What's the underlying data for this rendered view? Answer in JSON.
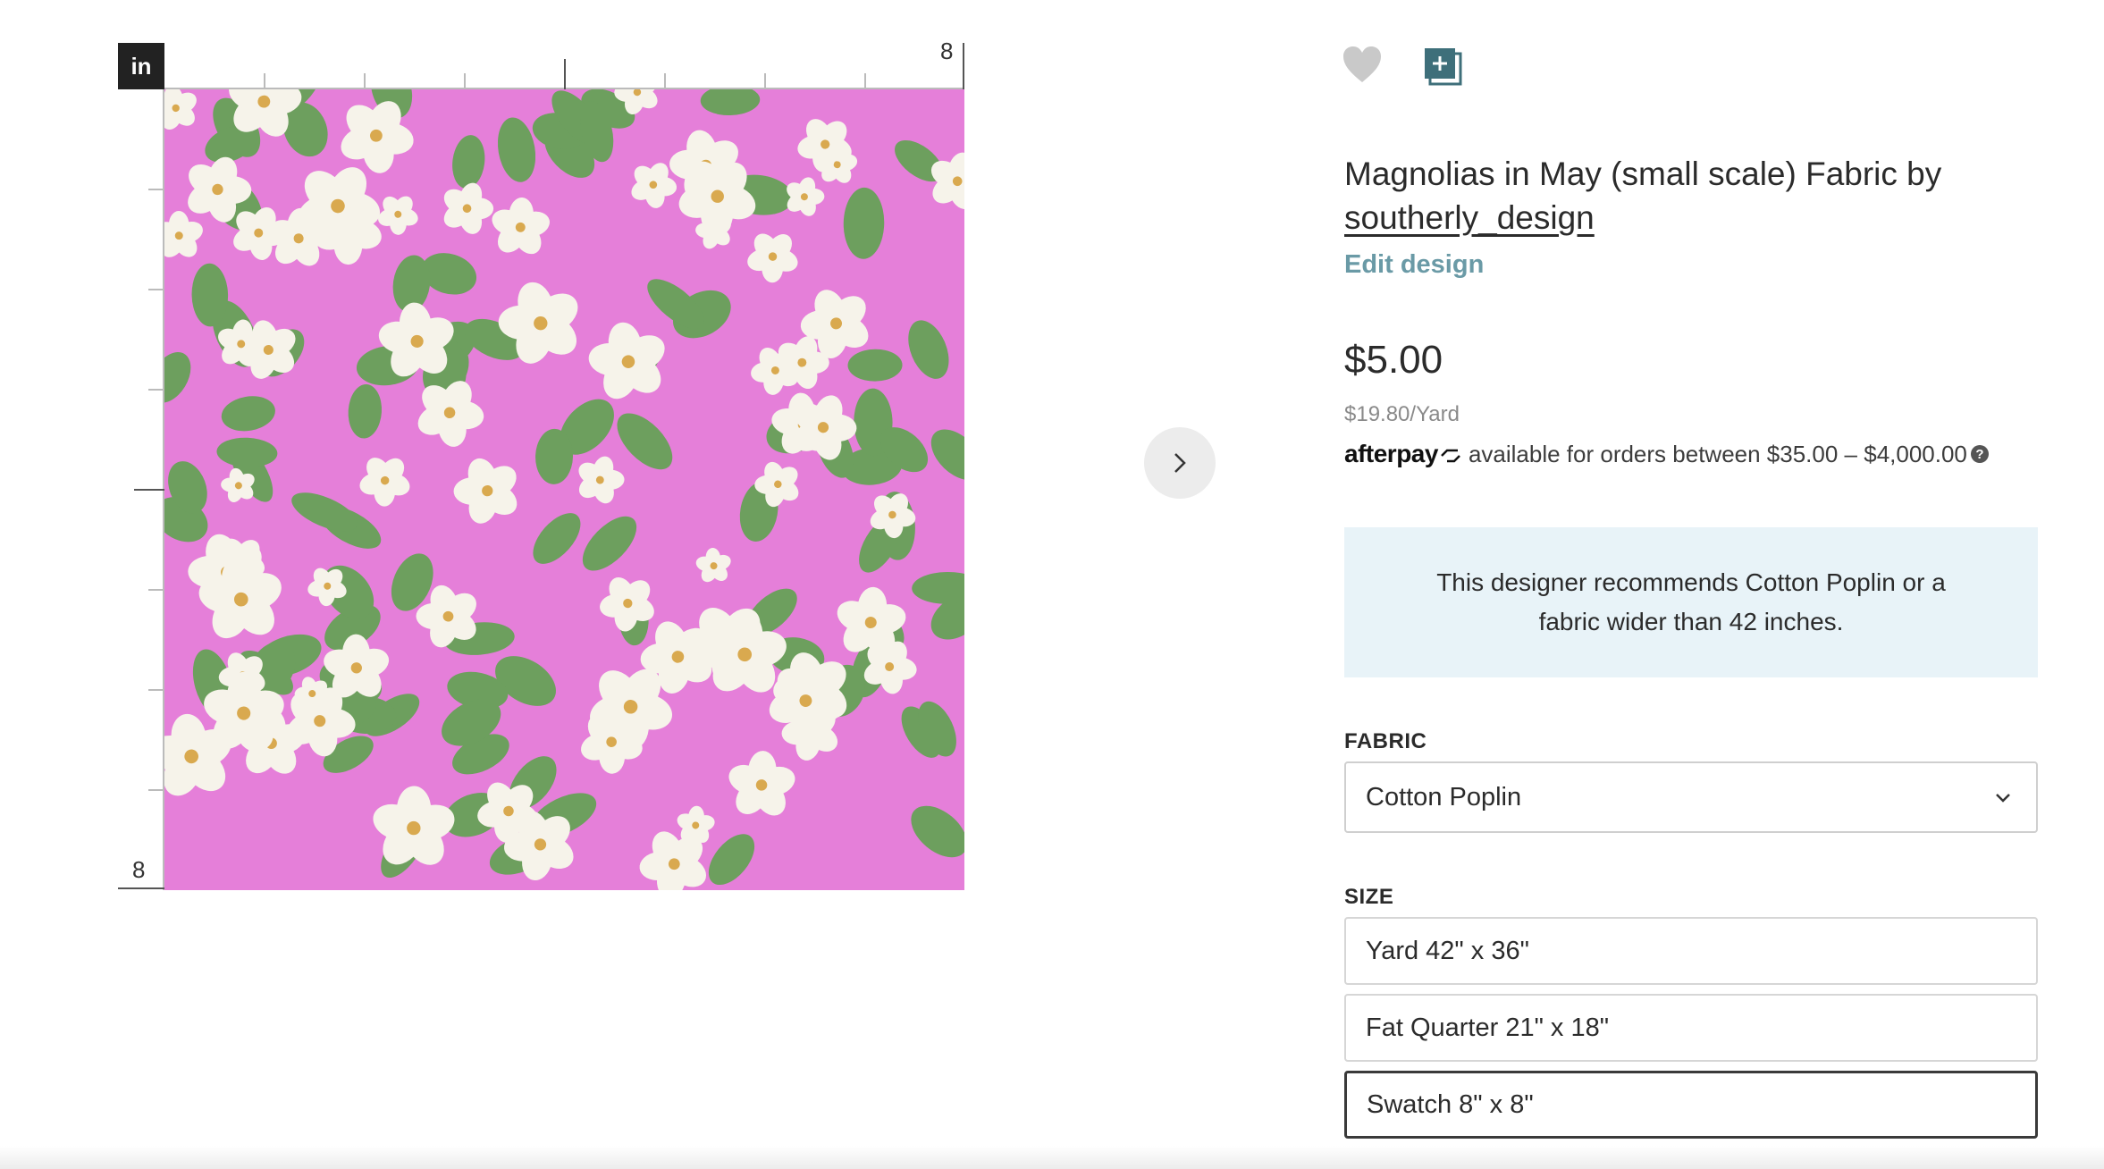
{
  "preview": {
    "unit_label": "in",
    "ruler_top_end": "8",
    "ruler_left_end": "8",
    "next_icon": "chevron-right-icon"
  },
  "product": {
    "title": "Magnolias in May (small scale) Fabric by",
    "designer": "southerly_design",
    "edit_label": "Edit design",
    "price": "$5.00",
    "unit_price": "$19.80/Yard",
    "afterpay_brand": "afterpay",
    "afterpay_text": "available for orders between $35.00 – $4,000.00",
    "afterpay_help": "?",
    "recommendation": "This designer recommends Cotton Poplin or a fabric wider than 42 inches."
  },
  "fabric": {
    "label": "FABRIC",
    "selected": "Cotton Poplin"
  },
  "size": {
    "label": "SIZE",
    "options": [
      "Yard 42\" x 36\"",
      "Fat Quarter 21\" x 18\"",
      "Swatch 8\" x 8\""
    ],
    "selected_index": 2
  },
  "icons": {
    "favorite": "heart-icon",
    "add_to_collection": "add-collection-icon"
  },
  "colors": {
    "fabric_background": "#e57fd9",
    "leaf": "#6d9f5e",
    "flower": "#f6f3ea",
    "flower_center": "#d9a94f",
    "accent_link": "#6a9aa6",
    "recommend_bg": "#e8f3f8",
    "icon_teal": "#3e6f7a"
  }
}
